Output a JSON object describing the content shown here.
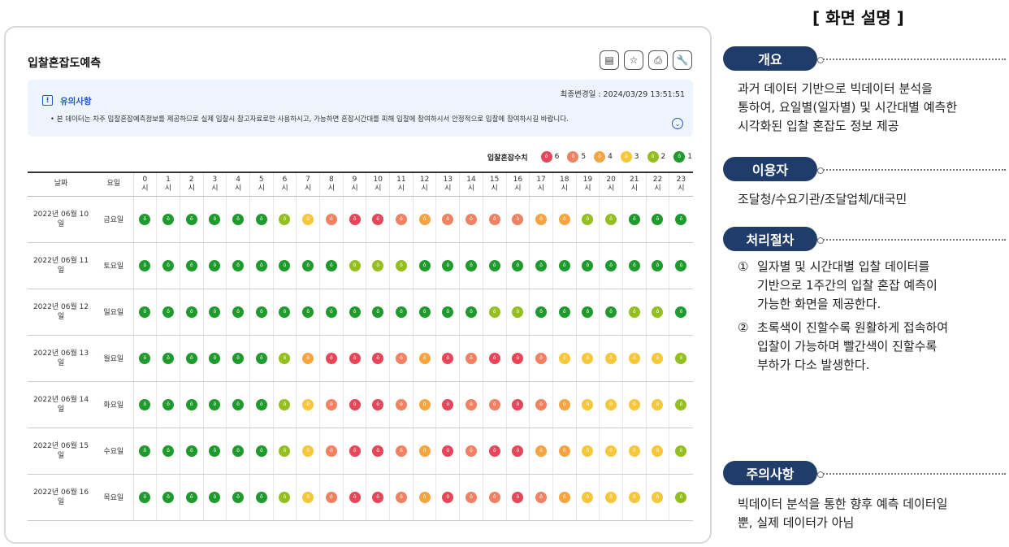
{
  "panel": {
    "title": "입찰혼잡도예측",
    "toolbar": [
      {
        "name": "bookmark-list-icon",
        "glyph": "▤"
      },
      {
        "name": "star-icon",
        "glyph": "☆"
      },
      {
        "name": "print-icon",
        "glyph": "⎙"
      },
      {
        "name": "wrench-icon",
        "glyph": "🔧"
      }
    ],
    "notice": {
      "updated": "최종변경일 : 2024/03/29 13:51:51",
      "icon": "!",
      "title": "유의사항",
      "body": "• 본 데이터는 차주 입찰혼잡예측정보를 제공하므로 실제 입찰시 참고자료로만 사용하시고, 가능하면 혼잡시간대를 피해 입찰에 참여하시서 안정적으로 입찰에 참여하시길 바랍니다.",
      "toggle": "⌄"
    },
    "legend": {
      "title": "입찰혼잡수치",
      "items": [
        {
          "level": 6,
          "label": "6"
        },
        {
          "level": 5,
          "label": "5"
        },
        {
          "level": 4,
          "label": "4"
        },
        {
          "level": 3,
          "label": "3"
        },
        {
          "level": 2,
          "label": "2"
        },
        {
          "level": 1,
          "label": "1"
        }
      ]
    },
    "table": {
      "headers": {
        "date": "날짜",
        "day": "요일",
        "hour_suffix": "시"
      },
      "hours": [
        "0",
        "1",
        "2",
        "3",
        "4",
        "5",
        "6",
        "7",
        "8",
        "9",
        "10",
        "11",
        "12",
        "13",
        "14",
        "15",
        "16",
        "17",
        "18",
        "19",
        "20",
        "21",
        "22",
        "23"
      ],
      "rows": [
        {
          "date": "2022년 06월 10일",
          "day": "금요일",
          "levels": [
            1,
            1,
            1,
            1,
            1,
            1,
            2,
            3,
            5,
            6,
            6,
            5,
            4,
            5,
            5,
            5,
            5,
            4,
            4,
            2,
            2,
            1,
            1,
            1
          ]
        },
        {
          "date": "2022년 06월 11일",
          "day": "토요일",
          "levels": [
            1,
            1,
            1,
            1,
            1,
            1,
            1,
            1,
            1,
            2,
            2,
            2,
            1,
            1,
            1,
            1,
            1,
            1,
            1,
            1,
            1,
            1,
            1,
            1
          ]
        },
        {
          "date": "2022년 06월 12일",
          "day": "일요일",
          "levels": [
            1,
            1,
            1,
            1,
            1,
            1,
            1,
            1,
            1,
            1,
            1,
            1,
            1,
            1,
            1,
            2,
            2,
            1,
            1,
            1,
            1,
            2,
            2,
            1
          ]
        },
        {
          "date": "2022년 06월 13일",
          "day": "월요일",
          "levels": [
            1,
            1,
            1,
            1,
            1,
            1,
            2,
            4,
            6,
            6,
            6,
            5,
            4,
            6,
            5,
            6,
            6,
            5,
            3,
            3,
            3,
            3,
            3,
            2
          ]
        },
        {
          "date": "2022년 06월 14일",
          "day": "화요일",
          "levels": [
            1,
            1,
            1,
            1,
            1,
            1,
            2,
            3,
            5,
            6,
            6,
            5,
            4,
            6,
            5,
            5,
            6,
            5,
            4,
            3,
            3,
            3,
            3,
            2
          ]
        },
        {
          "date": "2022년 06월 15일",
          "day": "수요일",
          "levels": [
            1,
            1,
            1,
            1,
            1,
            1,
            2,
            3,
            5,
            6,
            6,
            5,
            4,
            6,
            5,
            6,
            6,
            4,
            4,
            3,
            3,
            3,
            3,
            2
          ]
        },
        {
          "date": "2022년 06월 16일",
          "day": "목요일",
          "levels": [
            1,
            1,
            1,
            1,
            1,
            1,
            2,
            3,
            5,
            6,
            6,
            5,
            4,
            6,
            5,
            5,
            6,
            5,
            4,
            3,
            3,
            3,
            3,
            2
          ]
        }
      ],
      "dot_glyph": "ô"
    }
  },
  "colors": {
    "lv1": "#1f9b2e",
    "lv2": "#93bf21",
    "lv3": "#f6c73a",
    "lv4": "#f4a441",
    "lv5": "#f08162",
    "lv6": "#e74658",
    "pill": "#1f3c6b",
    "accent": "#2458c5"
  },
  "description": {
    "title": "[ 화면 설명 ]",
    "overview": {
      "label": "개요",
      "lines": [
        "과거 데이터 기반으로 빅데이터 분석을",
        "통하여, 요일별(일자별) 및 시간대별 예측한",
        "시각화된 입찰 혼잡도 정보 제공"
      ]
    },
    "users": {
      "label": "이용자",
      "text": "조달청/수요기관/조달업체/대국민"
    },
    "process": {
      "label": "처리절차",
      "steps": [
        {
          "num": "①",
          "lines": [
            "일자별 및 시간대별 입찰 데이터를",
            "기반으로 1주간의 입찰 혼잡 예측이",
            "가능한 화면을 제공한다."
          ]
        },
        {
          "num": "②",
          "lines": [
            "초록색이 진할수록 원활하게 접속하여",
            "입찰이 가능하며 빨간색이 진할수록",
            "부하가 다소 발생한다."
          ]
        }
      ]
    },
    "caution": {
      "label": "주의사항",
      "lines": [
        "빅데이터 분석을 통한 향후 예측 데이터일",
        "뿐, 실제 데이터가 아님"
      ]
    }
  }
}
